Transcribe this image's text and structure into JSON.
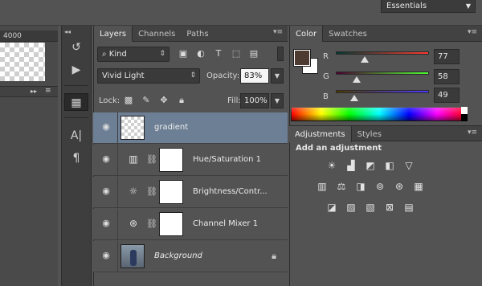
{
  "workspace": {
    "label": "Essentials"
  },
  "ruler": {
    "value": "4000"
  },
  "layers_panel": {
    "tabs": [
      {
        "label": "Layers"
      },
      {
        "label": "Channels"
      },
      {
        "label": "Paths"
      }
    ],
    "filter_kind": "Kind",
    "blend_mode": "Vivid Light",
    "opacity_label": "Opacity:",
    "opacity_value": "83%",
    "lock_label": "Lock:",
    "fill_label": "Fill:",
    "fill_value": "100%",
    "layers": [
      {
        "name": "gradient",
        "selected": true
      },
      {
        "name": "Hue/Saturation 1"
      },
      {
        "name": "Brightness/Contr..."
      },
      {
        "name": "Channel Mixer 1"
      },
      {
        "name": "Background",
        "locked": true
      }
    ]
  },
  "color_panel": {
    "tabs": [
      {
        "label": "Color"
      },
      {
        "label": "Swatches"
      }
    ],
    "channels": [
      {
        "label": "R",
        "value": "77"
      },
      {
        "label": "G",
        "value": "58"
      },
      {
        "label": "B",
        "value": "49"
      }
    ],
    "foreground": "#4d3a31",
    "background": "#ffffff"
  },
  "adjustments_panel": {
    "tabs": [
      {
        "label": "Adjustments"
      },
      {
        "label": "Styles"
      }
    ],
    "heading": "Add an adjustment"
  }
}
